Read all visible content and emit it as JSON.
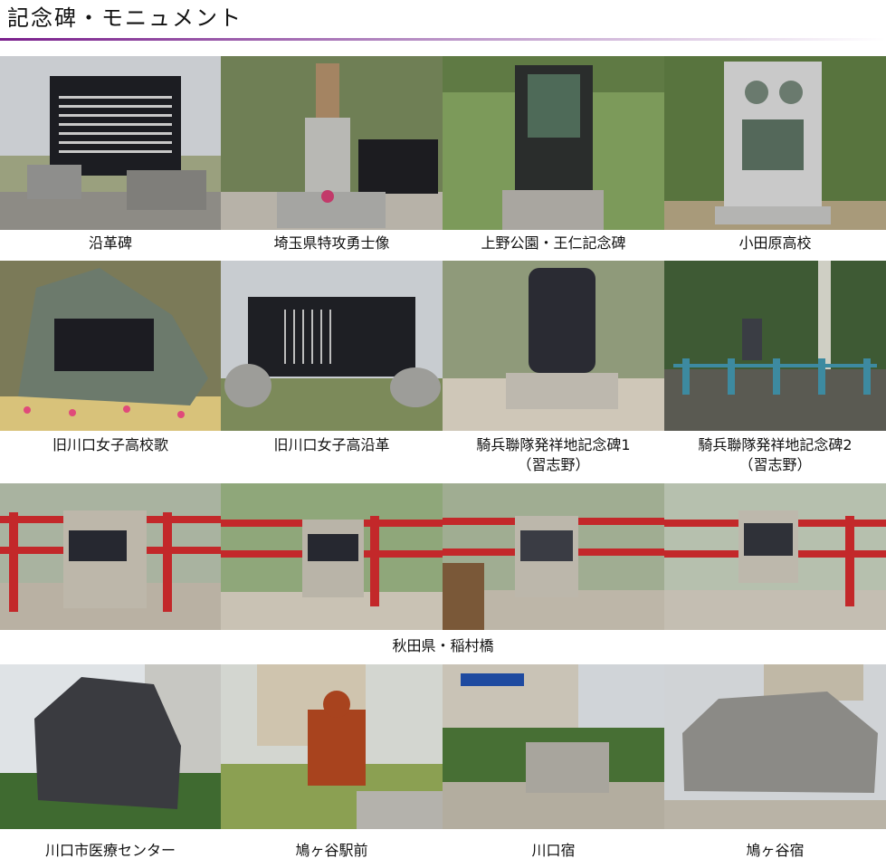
{
  "page": {
    "title": "記念碑・モニュメント"
  },
  "colors": {
    "rule_start": "#7a1f8c",
    "rule_end": "#ffffff"
  },
  "rows": [
    {
      "captions": [
        "沿革碑",
        "埼玉県特攻勇士像",
        "上野公園・王仁記念碑",
        "小田原高校"
      ]
    },
    {
      "captions": [
        "旧川口女子高校歌",
        "旧川口女子高沿革",
        "騎兵聯隊発祥地記念碑1\n（習志野）",
        "騎兵聯隊発祥地記念碑2\n（習志野）"
      ]
    },
    {
      "captions": [],
      "shared_caption": "秋田県・稲村橋"
    },
    {
      "captions": [
        "川口市医療センター",
        "鳩ヶ谷駅前",
        "川口宿",
        "鳩ヶ谷宿"
      ]
    }
  ]
}
